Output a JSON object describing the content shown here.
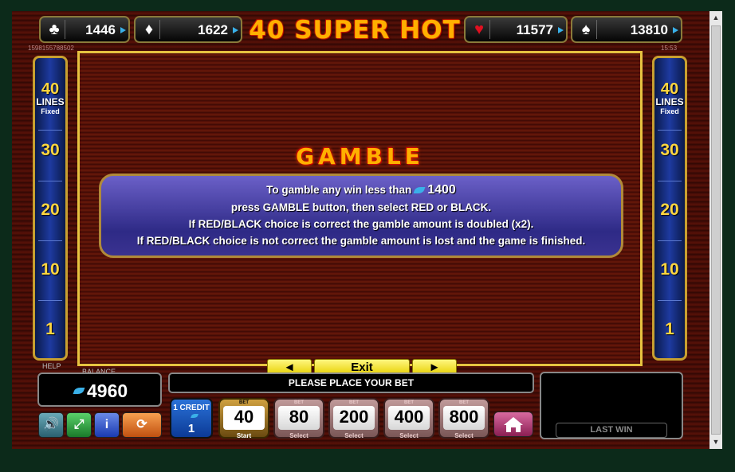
{
  "game": {
    "title": "40 SUPER HOT",
    "session_id": "1598155788502",
    "clock": "15:53"
  },
  "jackpots": [
    {
      "suit": "club",
      "glyph": "♣",
      "value": "1446",
      "superscript": "6"
    },
    {
      "suit": "diamond",
      "glyph": "♦",
      "value": "1622",
      "superscript": "2"
    },
    {
      "suit": "heart",
      "glyph": "♥",
      "value": "11577",
      "superscript": "7"
    },
    {
      "suit": "spade",
      "glyph": "♠",
      "value": "13810",
      "superscript": "0"
    }
  ],
  "lines_panel": {
    "count": "40",
    "label": "LINES",
    "mode": "Fixed",
    "markers": [
      "30",
      "20",
      "10",
      "1"
    ]
  },
  "gamble_info": {
    "heading": "GAMBLE",
    "line1_prefix": "To gamble any win less than",
    "line1_amount": "1400",
    "line2": "press GAMBLE button, then select RED or BLACK.",
    "line3": "If RED/BLACK choice is correct the gamble amount is doubled (x2).",
    "line4": "If RED/BLACK choice is not correct the gamble amount is lost and the game is finished."
  },
  "navigation": {
    "prev": "◄",
    "exit": "Exit",
    "next": "►"
  },
  "status": {
    "help_label": "HELP",
    "balance_label": "BALANCE",
    "balance": "4960",
    "message": "PLEASE PLACE YOUR BET",
    "last_win_label": "LAST WIN"
  },
  "controls": {
    "sound_icon": "speaker-icon",
    "fullscreen_icon": "fullscreen-icon",
    "info_label": "i",
    "autoplay_icon": "autoplay-icon",
    "credit_label": "1 CREDIT",
    "credit_value": "1"
  },
  "bets": [
    {
      "top": "BET",
      "value": "40",
      "bottom": "Start",
      "active": true
    },
    {
      "top": "BET",
      "value": "80",
      "bottom": "Select",
      "active": false
    },
    {
      "top": "BET",
      "value": "200",
      "bottom": "Select",
      "active": false
    },
    {
      "top": "BET",
      "value": "400",
      "bottom": "Select",
      "active": false
    },
    {
      "top": "BET",
      "value": "800",
      "bottom": "Select",
      "active": false
    }
  ],
  "colors": {
    "accent_gold": "#e6c340",
    "title_orange": "#ffb000",
    "info_blue": "#2e2a86",
    "coin_blue": "#3ab0e8"
  }
}
